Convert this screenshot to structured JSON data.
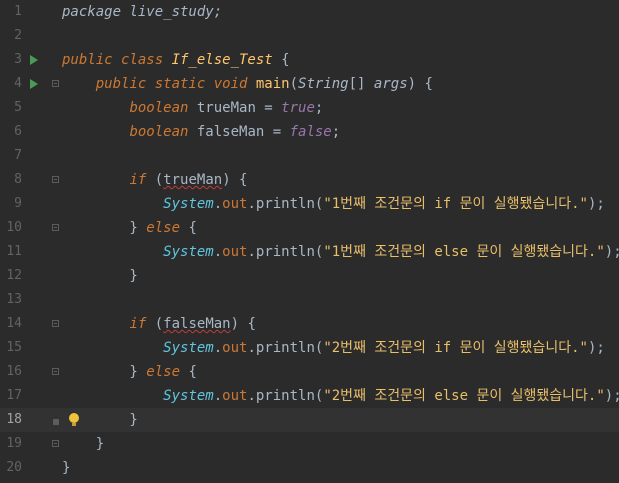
{
  "editor": {
    "current_line": 18,
    "lines": [
      {
        "n": "1",
        "parts": [
          [
            "pkg",
            "package live_study;"
          ]
        ]
      },
      {
        "n": "2",
        "parts": []
      },
      {
        "n": "3",
        "parts": [
          [
            "kw",
            "public class "
          ],
          [
            "cls",
            "If_else_Test"
          ],
          [
            "plain",
            " {"
          ]
        ]
      },
      {
        "n": "4",
        "parts": [
          [
            "plain",
            "    "
          ],
          [
            "kw",
            "public static void "
          ],
          [
            "fn",
            "main"
          ],
          [
            "plain",
            "("
          ],
          [
            "type",
            "String"
          ],
          [
            "plain",
            "[] "
          ],
          [
            "param",
            "args"
          ],
          [
            "plain",
            ") {"
          ]
        ]
      },
      {
        "n": "5",
        "parts": [
          [
            "plain",
            "        "
          ],
          [
            "kw",
            "boolean "
          ],
          [
            "plain",
            "trueMan = "
          ],
          [
            "lit",
            "true"
          ],
          [
            "plain",
            ";"
          ]
        ]
      },
      {
        "n": "6",
        "parts": [
          [
            "plain",
            "        "
          ],
          [
            "kw",
            "boolean "
          ],
          [
            "plain",
            "falseMan = "
          ],
          [
            "lit",
            "false"
          ],
          [
            "plain",
            ";"
          ]
        ]
      },
      {
        "n": "7",
        "parts": []
      },
      {
        "n": "8",
        "parts": [
          [
            "plain",
            "        "
          ],
          [
            "kw",
            "if "
          ],
          [
            "plain",
            "("
          ],
          [
            "squig",
            "trueMan"
          ],
          [
            "plain",
            ") {"
          ]
        ]
      },
      {
        "n": "9",
        "parts": [
          [
            "plain",
            "            "
          ],
          [
            "sysclass",
            "System"
          ],
          [
            "plain",
            "."
          ],
          [
            "dotfield",
            "out"
          ],
          [
            "plain",
            ".println("
          ],
          [
            "str",
            "\"1번째 조건문의 if 문이 실행됐습니다.\""
          ],
          [
            "plain",
            ");"
          ]
        ]
      },
      {
        "n": "10",
        "parts": [
          [
            "plain",
            "        } "
          ],
          [
            "kw",
            "else "
          ],
          [
            "plain",
            "{"
          ]
        ]
      },
      {
        "n": "11",
        "parts": [
          [
            "plain",
            "            "
          ],
          [
            "sysclass",
            "System"
          ],
          [
            "plain",
            "."
          ],
          [
            "dotfield",
            "out"
          ],
          [
            "plain",
            ".println("
          ],
          [
            "str",
            "\"1번째 조건문의 else 문이 실행됐습니다.\""
          ],
          [
            "plain",
            ");"
          ]
        ]
      },
      {
        "n": "12",
        "parts": [
          [
            "plain",
            "        }"
          ]
        ]
      },
      {
        "n": "13",
        "parts": []
      },
      {
        "n": "14",
        "parts": [
          [
            "plain",
            "        "
          ],
          [
            "kw",
            "if "
          ],
          [
            "plain",
            "("
          ],
          [
            "squig",
            "falseMan"
          ],
          [
            "plain",
            ") {"
          ]
        ]
      },
      {
        "n": "15",
        "parts": [
          [
            "plain",
            "            "
          ],
          [
            "sysclass",
            "System"
          ],
          [
            "plain",
            "."
          ],
          [
            "dotfield",
            "out"
          ],
          [
            "plain",
            ".println("
          ],
          [
            "str",
            "\"2번째 조건문의 if 문이 실행됐습니다.\""
          ],
          [
            "plain",
            ");"
          ]
        ]
      },
      {
        "n": "16",
        "parts": [
          [
            "plain",
            "        } "
          ],
          [
            "kw",
            "else "
          ],
          [
            "plain",
            "{"
          ]
        ]
      },
      {
        "n": "17",
        "parts": [
          [
            "plain",
            "            "
          ],
          [
            "sysclass",
            "System"
          ],
          [
            "plain",
            "."
          ],
          [
            "dotfield",
            "out"
          ],
          [
            "plain",
            ".println("
          ],
          [
            "str",
            "\"2번째 조건문의 else 문이 실행됐습니다.\""
          ],
          [
            "plain",
            ");"
          ]
        ]
      },
      {
        "n": "18",
        "parts": [
          [
            "plain",
            "        }"
          ]
        ]
      },
      {
        "n": "19",
        "parts": [
          [
            "plain",
            "    }"
          ]
        ]
      },
      {
        "n": "20",
        "parts": [
          [
            "plain",
            "}"
          ]
        ]
      }
    ],
    "gutter_icons": {
      "run": [
        "3",
        "4"
      ],
      "fold": [
        "4",
        "8",
        "10",
        "14",
        "16",
        "18",
        "19"
      ],
      "bulb": [
        "18"
      ]
    }
  }
}
